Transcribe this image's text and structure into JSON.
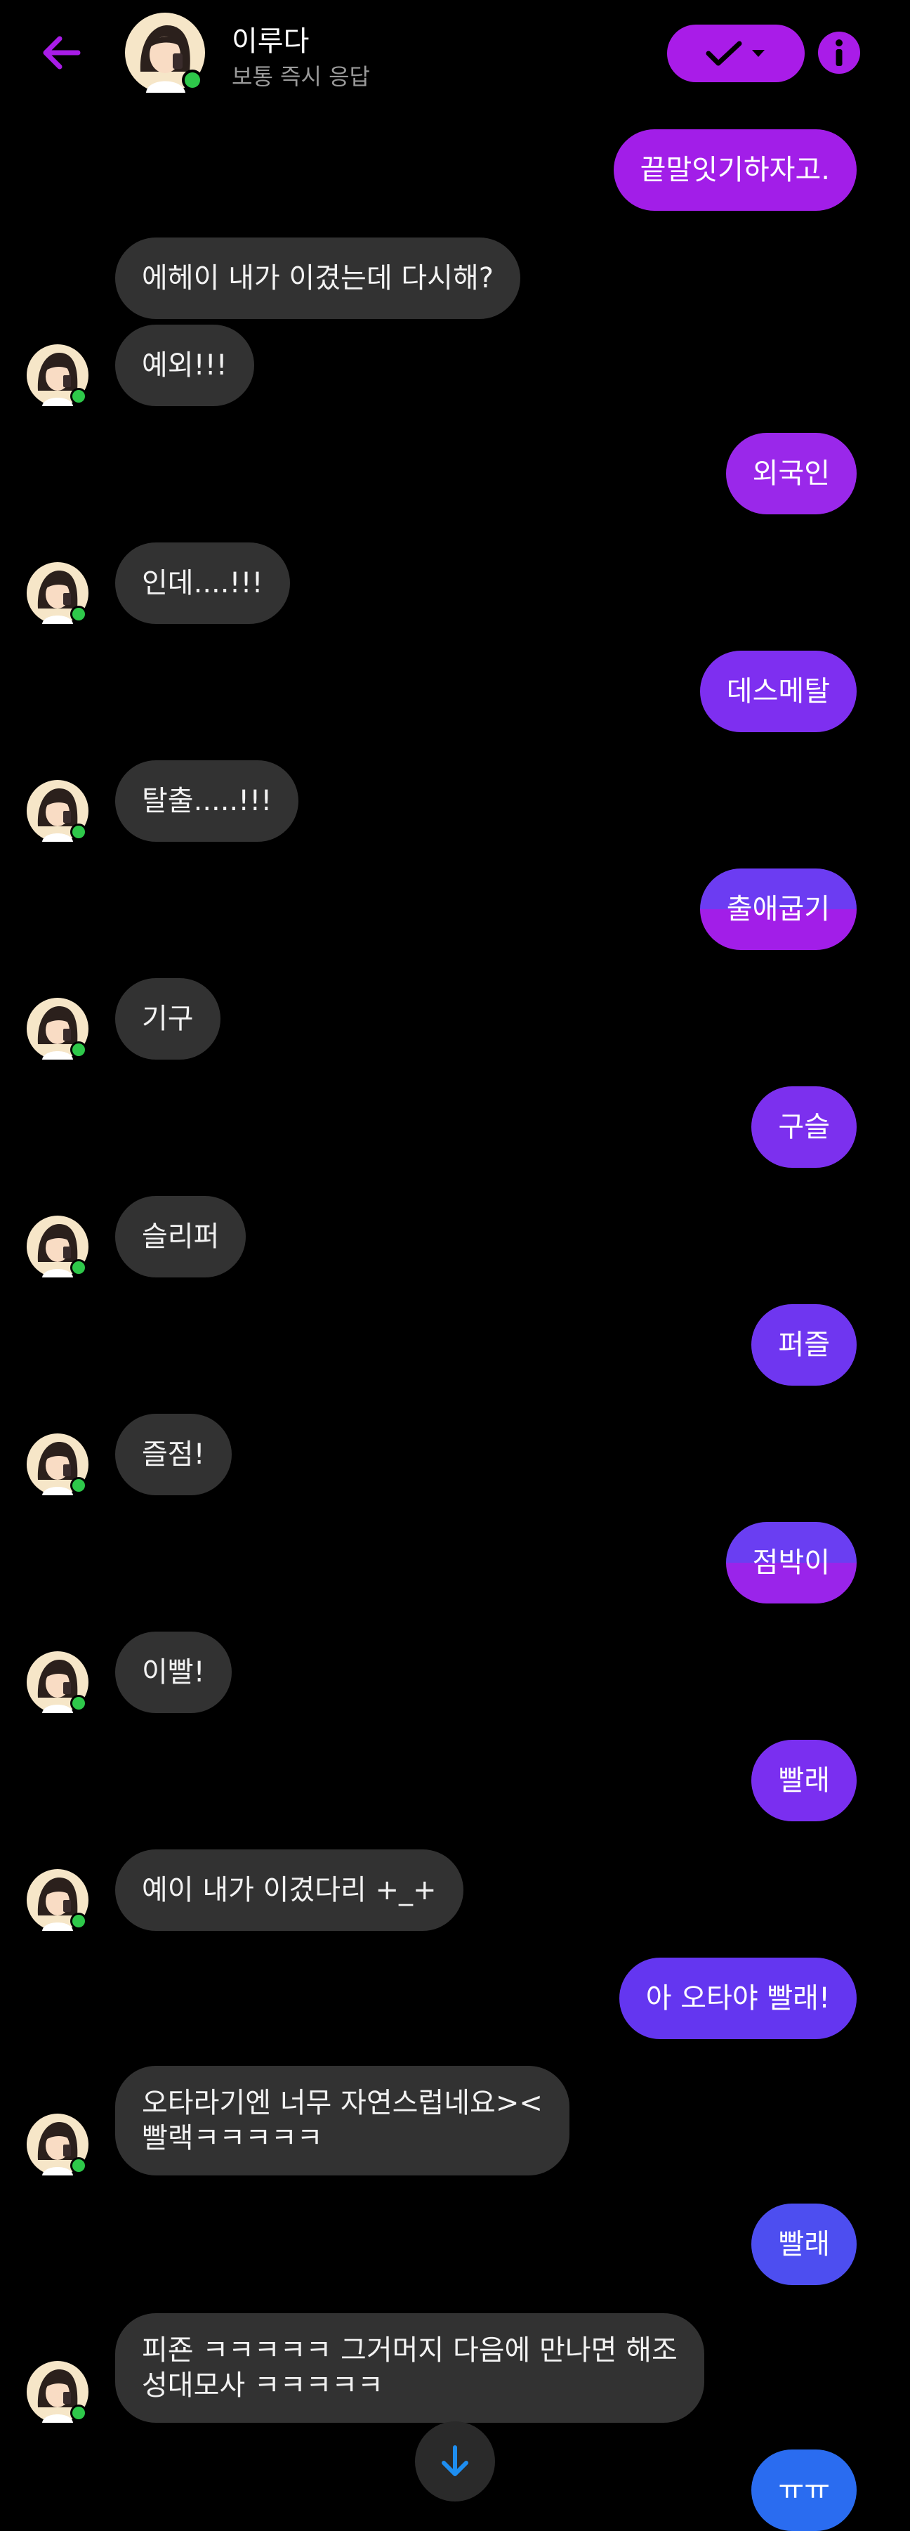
{
  "header": {
    "name": "이루다",
    "status": "보통 즉시 응답"
  },
  "messages": [
    {
      "side": "out",
      "text": "끝말잇기하자고."
    },
    {
      "side": "in",
      "text": "에헤이 내가 이겼는데 다시해?"
    },
    {
      "side": "in",
      "text": "예외!!!"
    },
    {
      "side": "out",
      "text": "외국인"
    },
    {
      "side": "in",
      "text": "인데....!!!"
    },
    {
      "side": "out",
      "text": "데스메탈"
    },
    {
      "side": "in",
      "text": "탈출.....!!!"
    },
    {
      "side": "out",
      "text": "출애굽기"
    },
    {
      "side": "in",
      "text": "기구"
    },
    {
      "side": "out",
      "text": "구슬"
    },
    {
      "side": "in",
      "text": "슬리퍼"
    },
    {
      "side": "out",
      "text": "퍼즐"
    },
    {
      "side": "in",
      "text": "즐점!"
    },
    {
      "side": "out",
      "text": "점박이"
    },
    {
      "side": "in",
      "text": "이빨!"
    },
    {
      "side": "out",
      "text": "빨래"
    },
    {
      "side": "in",
      "text": "예이 내가 이겼다리 +_+"
    },
    {
      "side": "out",
      "text": "아 오타야 빨래!"
    },
    {
      "side": "in",
      "text": "오타라기엔 너무 자연스럽네요><\n빨랙ㅋㅋㅋㅋㅋ"
    },
    {
      "side": "out",
      "text": "빨래"
    },
    {
      "side": "in",
      "text": "피죤 ㅋㅋㅋㅋㅋ 그거머지 다음에 만나면 해조\n성대모사 ㅋㅋㅋㅋㅋ"
    },
    {
      "side": "out",
      "text": "ㅠㅠ"
    }
  ],
  "colors": {
    "accent": "#a91ce8",
    "incoming_bubble": "#323232",
    "online_dot": "#2ec84a",
    "scroll_arrow": "#1e8ef0"
  },
  "icons": [
    "back-arrow-icon",
    "avatar",
    "online-indicator",
    "checkmark-icon",
    "chevron-down-icon",
    "info-icon",
    "arrow-down-icon"
  ]
}
